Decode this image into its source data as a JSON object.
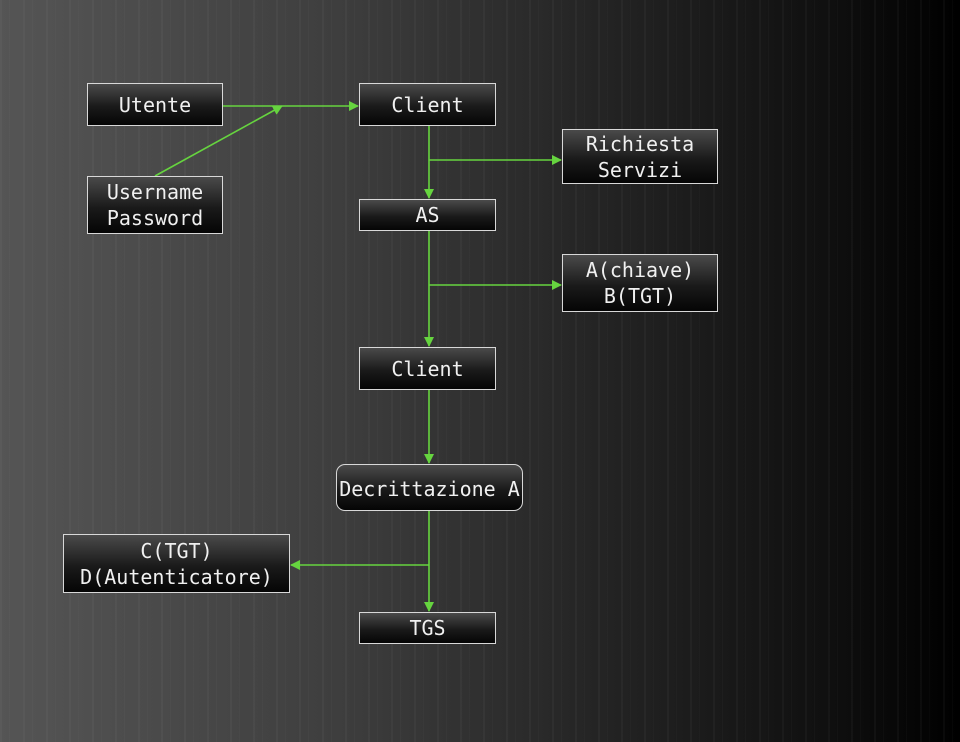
{
  "nodes": {
    "utente": [
      "Utente"
    ],
    "credentials": [
      "Username",
      "Password"
    ],
    "client1": [
      "Client"
    ],
    "as": [
      "AS"
    ],
    "request": [
      "Richiesta",
      "Servizi"
    ],
    "response": [
      "A(chiave)",
      "B(TGT)"
    ],
    "client2": [
      "Client"
    ],
    "decrypt": [
      "Decrittazione A"
    ],
    "tgs_msg": [
      "C(TGT)",
      "D(Autenticatore)"
    ],
    "tgs": [
      "TGS"
    ]
  },
  "colors": {
    "edge": "#66d43f",
    "border": "#d8d8d8"
  }
}
